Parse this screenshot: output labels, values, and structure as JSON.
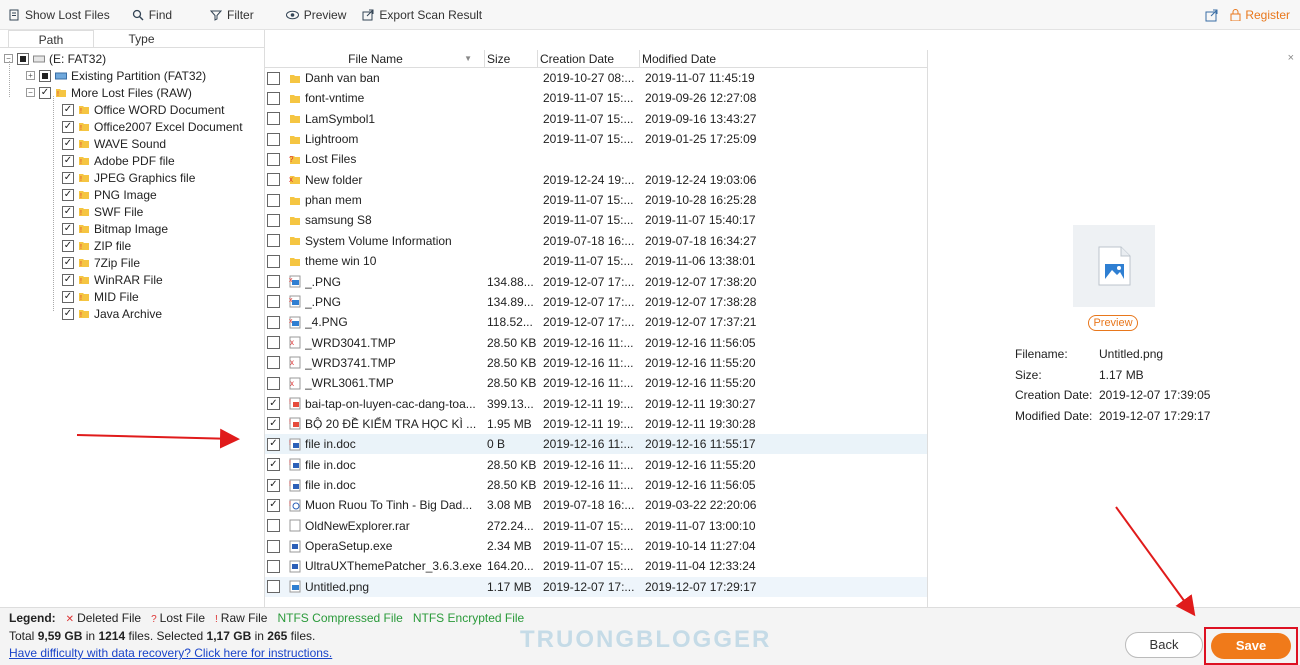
{
  "toolbar": {
    "show_lost_files": "Show Lost Files",
    "find": "Find",
    "filter": "Filter",
    "preview": "Preview",
    "export": "Export Scan Result",
    "register": "Register"
  },
  "tabs": {
    "path": "Path",
    "type": "Type"
  },
  "tree": {
    "root": "(E: FAT32)",
    "existing": "Existing Partition (FAT32)",
    "more_lost": "More Lost Files (RAW)",
    "items": [
      "Office WORD Document",
      "Office2007 Excel Document",
      "WAVE Sound",
      "Adobe PDF file",
      "JPEG Graphics file",
      "PNG Image",
      "SWF File",
      "Bitmap Image",
      "ZIP file",
      "7Zip File",
      "WinRAR File",
      "MID File",
      "Java Archive"
    ]
  },
  "list": {
    "headers": {
      "name": "File Name",
      "size": "Size",
      "created": "Creation Date",
      "modified": "Modified Date"
    },
    "rows": [
      {
        "name": "Danh van ban",
        "size": "",
        "created": "2019-10-27 08:...",
        "modified": "2019-11-07 11:45:19",
        "icon": "folder",
        "checked": false
      },
      {
        "name": "font-vntime",
        "size": "",
        "created": "2019-11-07 15:...",
        "modified": "2019-09-26 12:27:08",
        "icon": "folder",
        "checked": false
      },
      {
        "name": "LamSymbol1",
        "size": "",
        "created": "2019-11-07 15:...",
        "modified": "2019-09-16 13:43:27",
        "icon": "folder",
        "checked": false
      },
      {
        "name": "Lightroom",
        "size": "",
        "created": "2019-11-07 15:...",
        "modified": "2019-01-25 17:25:09",
        "icon": "folder",
        "checked": false
      },
      {
        "name": "Lost Files",
        "size": "",
        "created": "",
        "modified": "",
        "icon": "folder-lost",
        "checked": false
      },
      {
        "name": "New folder",
        "size": "",
        "created": "2019-12-24 19:...",
        "modified": "2019-12-24 19:03:06",
        "icon": "folder-deleted",
        "checked": false
      },
      {
        "name": "phan mem",
        "size": "",
        "created": "2019-11-07 15:...",
        "modified": "2019-10-28 16:25:28",
        "icon": "folder",
        "checked": false
      },
      {
        "name": "samsung S8",
        "size": "",
        "created": "2019-11-07 15:...",
        "modified": "2019-11-07 15:40:17",
        "icon": "folder",
        "checked": false
      },
      {
        "name": "System Volume Information",
        "size": "",
        "created": "2019-07-18 16:...",
        "modified": "2019-07-18 16:34:27",
        "icon": "folder",
        "checked": false
      },
      {
        "name": "theme win 10",
        "size": "",
        "created": "2019-11-07 15:...",
        "modified": "2019-11-06 13:38:01",
        "icon": "folder",
        "checked": false
      },
      {
        "name": "_.PNG",
        "size": "134.88...",
        "created": "2019-12-07 17:...",
        "modified": "2019-12-07 17:38:20",
        "icon": "image-deleted",
        "checked": false
      },
      {
        "name": "_.PNG",
        "size": "134.89...",
        "created": "2019-12-07 17:...",
        "modified": "2019-12-07 17:38:28",
        "icon": "image-deleted",
        "checked": false
      },
      {
        "name": "_4.PNG",
        "size": "118.52...",
        "created": "2019-12-07 17:...",
        "modified": "2019-12-07 17:37:21",
        "icon": "image-deleted",
        "checked": false
      },
      {
        "name": "_WRD3041.TMP",
        "size": "28.50 KB",
        "created": "2019-12-16 11:...",
        "modified": "2019-12-16 11:56:05",
        "icon": "file-deleted",
        "checked": false
      },
      {
        "name": "_WRD3741.TMP",
        "size": "28.50 KB",
        "created": "2019-12-16 11:...",
        "modified": "2019-12-16 11:55:20",
        "icon": "file-deleted",
        "checked": false
      },
      {
        "name": "_WRL3061.TMP",
        "size": "28.50 KB",
        "created": "2019-12-16 11:...",
        "modified": "2019-12-16 11:55:20",
        "icon": "file-deleted",
        "checked": false
      },
      {
        "name": "bai-tap-on-luyen-cac-dang-toa...",
        "size": "399.13...",
        "created": "2019-12-11 19:...",
        "modified": "2019-12-11 19:30:27",
        "icon": "pdf",
        "checked": true
      },
      {
        "name": "BỘ 20 ĐỀ KIỂM TRA HỌC KÌ ...",
        "size": "1.95 MB",
        "created": "2019-12-11 19:...",
        "modified": "2019-12-11 19:30:28",
        "icon": "pdf",
        "checked": true
      },
      {
        "name": "file in.doc",
        "size": "0 B",
        "created": "2019-12-16 11:...",
        "modified": "2019-12-16 11:55:17",
        "icon": "doc",
        "checked": true
      },
      {
        "name": "file in.doc",
        "size": "28.50 KB",
        "created": "2019-12-16 11:...",
        "modified": "2019-12-16 11:55:20",
        "icon": "doc",
        "checked": true
      },
      {
        "name": "file in.doc",
        "size": "28.50 KB",
        "created": "2019-12-16 11:...",
        "modified": "2019-12-16 11:56:05",
        "icon": "doc",
        "checked": true
      },
      {
        "name": "Muon Ruou To Tinh - Big Dad...",
        "size": "3.08 MB",
        "created": "2019-07-18 16:...",
        "modified": "2019-03-22 22:20:06",
        "icon": "audio",
        "checked": true
      },
      {
        "name": "OldNewExplorer.rar",
        "size": "272.24...",
        "created": "2019-11-07 15:...",
        "modified": "2019-11-07 13:00:10",
        "icon": "file",
        "checked": false
      },
      {
        "name": "OperaSetup.exe",
        "size": "2.34 MB",
        "created": "2019-11-07 15:...",
        "modified": "2019-10-14 11:27:04",
        "icon": "exe",
        "checked": false
      },
      {
        "name": "UltraUXThemePatcher_3.6.3.exe",
        "size": "164.20...",
        "created": "2019-11-07 15:...",
        "modified": "2019-11-04 12:33:24",
        "icon": "exe",
        "checked": false
      },
      {
        "name": "Untitled.png",
        "size": "1.17 MB",
        "created": "2019-12-07 17:...",
        "modified": "2019-12-07 17:29:17",
        "icon": "image",
        "checked": false
      }
    ]
  },
  "preview": {
    "button": "Preview",
    "filename_label": "Filename:",
    "filename": "Untitled.png",
    "size_label": "Size:",
    "size": "1.17 MB",
    "created_label": "Creation Date:",
    "created": "2019-12-07 17:39:05",
    "modified_label": "Modified Date:",
    "modified": "2019-12-07 17:29:17"
  },
  "legend": {
    "title": "Legend:",
    "deleted": "Deleted File",
    "lost": "Lost File",
    "raw": "Raw File",
    "compressed": "NTFS Compressed File",
    "encrypted": "NTFS Encrypted File"
  },
  "summary": {
    "total_prefix": "Total",
    "total_size": "9,59 GB",
    "in": "in",
    "total_files": "1214",
    "files_selected": "files. Selected",
    "sel_size": "1,17 GB",
    "in2": "in",
    "sel_files": "265",
    "files_end": "files."
  },
  "help_link": "Have difficulty with data recovery? Click here for instructions.",
  "watermark": "TRUONGBLOGGER",
  "buttons": {
    "back": "Back",
    "save": "Save"
  }
}
